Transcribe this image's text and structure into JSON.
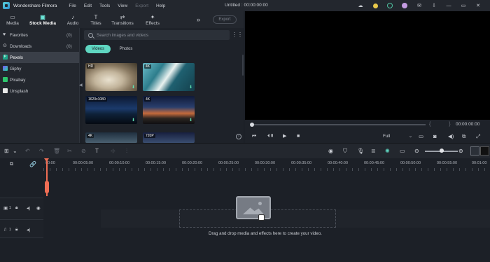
{
  "app": {
    "name": "Wondershare Filmora",
    "document_title": "Untitled : 00:00:00:00"
  },
  "menu": [
    "File",
    "Edit",
    "Tools",
    "View",
    "Export",
    "Help"
  ],
  "menu_disabled_index": 4,
  "window_controls": {
    "minimize": "—",
    "maximize": "▭",
    "close": "✕"
  },
  "tabs": [
    {
      "label": "Media",
      "icon": "▭"
    },
    {
      "label": "Stock Media",
      "icon": "▣"
    },
    {
      "label": "Audio",
      "icon": "♪"
    },
    {
      "label": "Titles",
      "icon": "T"
    },
    {
      "label": "Transitions",
      "icon": "⇄"
    },
    {
      "label": "Effects",
      "icon": "✦"
    }
  ],
  "active_tab": "Stock Media",
  "more_label": "»",
  "export_label": "Export",
  "sidebar": {
    "items": [
      {
        "label": "Favorites",
        "count": "(0)",
        "icon": "♥"
      },
      {
        "label": "Downloads",
        "count": "(0)",
        "icon": "⊙"
      },
      {
        "label": "Pexels",
        "count": "",
        "icon": "P"
      },
      {
        "label": "Giphy",
        "count": "",
        "icon": "G"
      },
      {
        "label": "Pixabay",
        "count": "",
        "icon": "px"
      },
      {
        "label": "Unsplash",
        "count": "",
        "icon": "U"
      }
    ],
    "selected": "Pexels"
  },
  "search": {
    "placeholder": "Search images and videos"
  },
  "filter": {
    "videos": "Videos",
    "photos": "Photos",
    "selected": "Videos"
  },
  "thumbnails": [
    {
      "badge": "HD"
    },
    {
      "badge": "4K"
    },
    {
      "badge": "1620x1080"
    },
    {
      "badge": "4K"
    },
    {
      "badge": "4K"
    },
    {
      "badge": "720P"
    }
  ],
  "player": {
    "timecode": "00:00:00:00",
    "braces": "{  }",
    "quality": "Full"
  },
  "ruler_labels": [
    "00:00",
    "00:00:05:00",
    "00:00:10:00",
    "00:00:15:00",
    "00:00:20:00",
    "00:00:25:00",
    "00:00:30:00",
    "00:00:35:00",
    "00:00:40:00",
    "00:00:45:00",
    "00:00:50:00",
    "00:00:55:00",
    "00:01:00"
  ],
  "tracks": [
    {
      "number": "1",
      "type": "video"
    },
    {
      "number": "1",
      "type": "audio"
    }
  ],
  "drop_hint": "Drag and drop media and effects here to create your video.",
  "colors": {
    "accent": "#5fd6c1",
    "playhead": "#ef6d54",
    "background": "#1c2027"
  }
}
